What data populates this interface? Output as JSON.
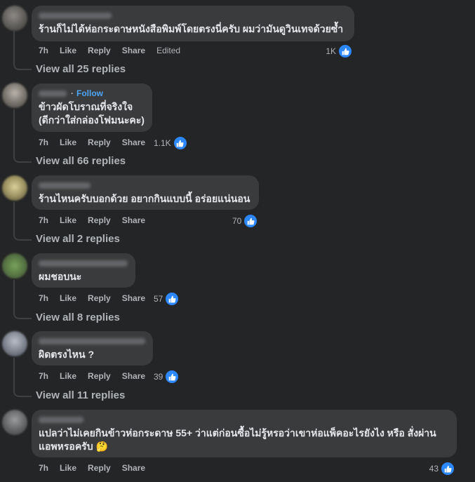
{
  "actions": {
    "time": "7h",
    "like": "Like",
    "reply": "Reply",
    "share": "Share",
    "edited": "Edited"
  },
  "comments": [
    {
      "text": "ร้านก็ไม่ได้ห่อกระดาษหนังสือพิมพ์โดยตรงนี่ครับ ผมว่ามันดูวินเทจด้วยซ้ำ",
      "reactions": "1K",
      "edited": true,
      "view_replies": "View all 25 replies"
    },
    {
      "follow": "Follow",
      "text": "ข้าวผัดโบราณที่จริงใจ\n(ดีกว่าใส่กล่องโฟมนะคะ)",
      "reactions": "1.1K",
      "view_replies": "View all 66 replies"
    },
    {
      "text": "ร้านไหนครับบอกด้วย อยากกินแบบนี้ อร่อยแน่นอน",
      "reactions": "70",
      "view_replies": "View all 2 replies"
    },
    {
      "text": "ผมชอบนะ",
      "reactions": "57",
      "view_replies": "View all 8 replies"
    },
    {
      "text": "ผิดตรงไหน ?",
      "reactions": "39",
      "view_replies": "View all 11 replies"
    },
    {
      "text": "แปลว่าไม่เคยกินข้าวห่อกระดาษ 55+ ว่าแต่ก่อนซื้อไม่รู้หรอว่าเขาห่อแพ็คอะไรยังไง หรือ สั่งผ่าน\nแอพหรอครับ",
      "emoji": "🤔",
      "reactions": "43"
    }
  ],
  "colors": {
    "background": "#242526",
    "bubble": "#3a3b3c",
    "like_blue": "#2d88ff",
    "follow_blue": "#4ea5f4",
    "muted": "#b0b3b8"
  },
  "icons": {
    "reaction": "thumbs-up-icon"
  }
}
